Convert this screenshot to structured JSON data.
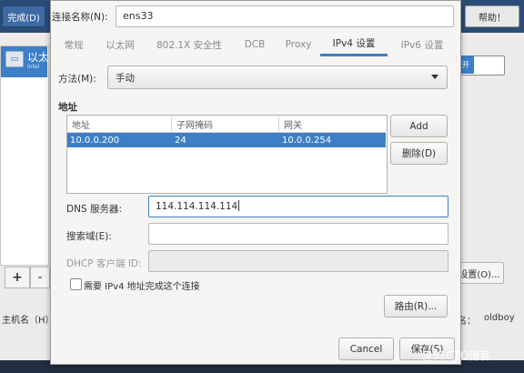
{
  "background": {
    "done_button": "完成(D)",
    "help_button": "帮助！",
    "list_item_label": "以太",
    "list_item_sub": "Intel",
    "add_button": "+",
    "remove_button": "-",
    "hostname_label": "主机名（H）",
    "toggle_text": "开",
    "settings_button": "设置(O)...",
    "hostname_value_label": "名：",
    "hostname_value": "oldboy"
  },
  "dialog": {
    "connection_name_label": "连接名称(N):",
    "connection_name_value": "ens33",
    "tabs": [
      {
        "label": "常规",
        "active": false
      },
      {
        "label": "以太网",
        "active": false
      },
      {
        "label": "802.1X 安全性",
        "active": false
      },
      {
        "label": "DCB",
        "active": false
      },
      {
        "label": "Proxy",
        "active": false
      },
      {
        "label": "IPv4 设置",
        "active": true
      },
      {
        "label": "IPv6 设置",
        "active": false
      }
    ],
    "method_label": "方法(M):",
    "method_value": "手动",
    "address_heading": "地址",
    "address_columns": [
      "地址",
      "子网掩码",
      "网关"
    ],
    "address_rows": [
      {
        "address": "10.0.0.200",
        "netmask": "24",
        "gateway": "10.0.0.254",
        "selected": true
      }
    ],
    "add_button": "Add",
    "delete_button": "删除(D)",
    "dns_label": "DNS 服务器:",
    "dns_value": "114.114.114.114",
    "search_domain_label": "搜索域(E):",
    "search_domain_value": "",
    "dhcp_client_id_label": "DHCP 客户端 ID:",
    "dhcp_client_id_value": "",
    "require_ipv4_label": "需要 IPv4 地址完成这个连接",
    "require_ipv4_checked": false,
    "routes_button": "路由(R)...",
    "cancel_button": "Cancel",
    "save_button": "保存(S)"
  },
  "watermark": "@51CTO博客",
  "colors": {
    "accent": "#3c7fc7",
    "titlebar": "#2a4d77"
  }
}
